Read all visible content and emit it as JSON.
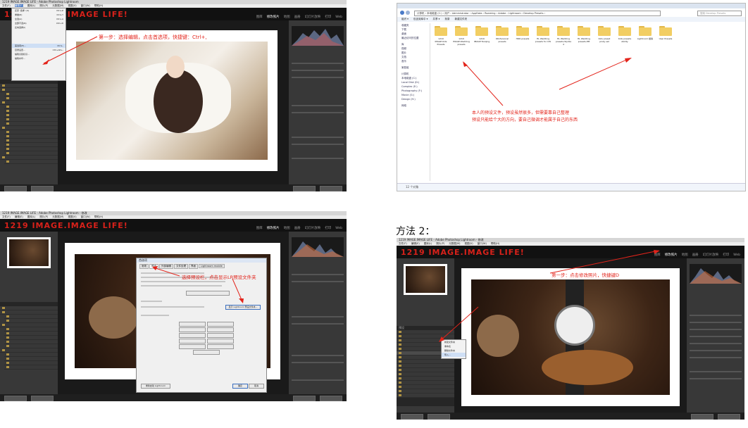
{
  "lr_common": {
    "logo": "1219 IMAGE.IMAGE LIFE!",
    "modules": [
      "图库",
      "修改照片",
      "地图",
      "画册",
      "幻灯片放映",
      "打印",
      "Web"
    ],
    "active_module": "修改照片",
    "menus": [
      "文件(F)",
      "编辑(E)",
      "图库(L)",
      "照片(P)",
      "元数据(M)",
      "视图(V)",
      "窗口(W)",
      "帮助(H)"
    ]
  },
  "panel1": {
    "window_title": "1219 IMAGE.IMAGE LIFE - Adobe Photoshop Lightroom",
    "annotation": "第一步：选择编辑，点击首选项，快捷键：Ctrl+,",
    "menu_items": [
      "还原 '选择' (U)",
      "重做(R)",
      "全选(A)",
      "全部不选(N)",
      "反向选择(I)",
      "首选项(P)...",
      "目录设置...",
      "编辑识别标识...",
      "编辑水印..."
    ],
    "shortcuts": [
      "Ctrl+Z",
      "Ctrl+Y",
      "Ctrl+A",
      "Ctrl+D",
      "",
      "Ctrl+,",
      "Ctrl+Alt+,",
      "",
      ""
    ],
    "highlight_item": "首选项(P)..."
  },
  "panel2": {
    "address": "计算机 › 本地磁盘 (C:) › 用户 › Administrator › AppData › Roaming › Adobe › Lightroom › Develop Presets ›",
    "search_placeholder": "搜索 Develop Presets",
    "toolbar": [
      "组织 ▾",
      "包含到库中 ▾",
      "共享 ▾",
      "刻录",
      "新建文件夹"
    ],
    "nav_items": [
      "收藏夹",
      "下载",
      "桌面",
      "最近访问的位置",
      "库",
      "视频",
      "图片",
      "文档",
      "音乐",
      "家庭组",
      "计算机",
      "本地磁盘 (C:)",
      "Local Disk (D:)",
      "Complex (E:)",
      "Photography (F:)",
      "Movie (G:)",
      "Design (H:)",
      "网络"
    ],
    "folders": [
      "1219 IMAGE:Kids Presets",
      "1219 IMAGE:Wedding presets",
      "1219 IMAGE:Tanqing",
      "DR-Personal presets",
      "HDR presets",
      "HL Wedding presets for CW",
      "HL Wedding presets-Stylize 4",
      "HL Wedding presets-PM",
      "Kids preset pinky set",
      "Kids presets Ability",
      "Lightroom 模拟",
      "User Presets"
    ],
    "annotation_line1": "本人的预设文件，预设虽然很多，但需要靠自己整理",
    "annotation_line2": "预设只能给个大的方向，要自己微调才能属于自己的东西",
    "status": "12 个对象"
  },
  "panel3": {
    "window_title": "1219 IMAGE.IMAGE LIFE - Adobe Photoshop Lightroom - 修改",
    "annotation": "选择预设栏，点击显示LR预设文件夹",
    "dialog_title": "首选项",
    "dialog_tabs": [
      "常规",
      "预设",
      "外部编辑",
      "文件处理",
      "界面",
      "Lightroom mobile"
    ],
    "active_tab": "预设",
    "show_folder_button": "显示 Lightroom 预设文件夹...",
    "restart_button": "重新启动 Lightroom",
    "ok_button": "确定",
    "cancel_button": "取消"
  },
  "method2": {
    "label": "方法 2："
  },
  "panel4": {
    "window_title": "1219 IMAGE.IMAGE LIFE - Adobe Photoshop Lightroom - 修改",
    "annotation": "第一步：点击修改照片，快捷键D",
    "context_menu": [
      "新建文件夹",
      "重命名",
      "删除文件夹",
      "导入..."
    ],
    "presets_title": "预设"
  }
}
